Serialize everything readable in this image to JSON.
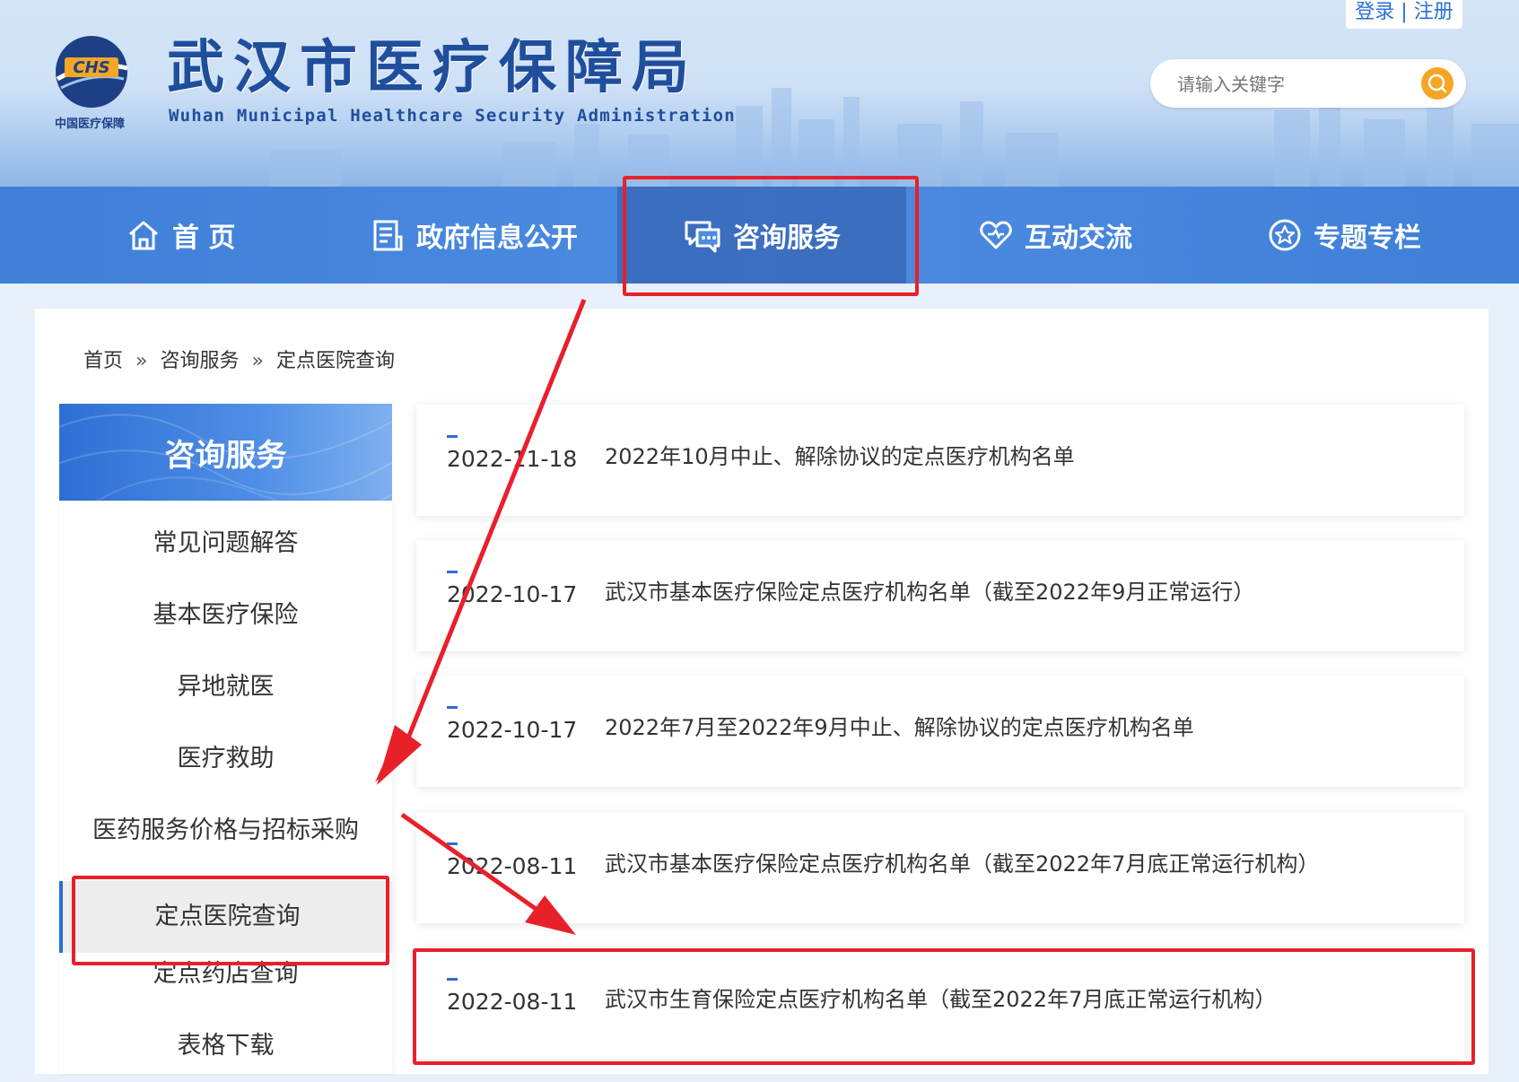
{
  "header": {
    "logo_text": "中国医疗保障",
    "title": "武汉市医疗保障局",
    "subtitle": "Wuhan Municipal Healthcare Security Administration",
    "login": "登录",
    "separator": "|",
    "register": "注册",
    "search_placeholder": "请输入关键字"
  },
  "nav": {
    "items": [
      {
        "label": "首 页",
        "icon": "home-icon"
      },
      {
        "label": "政府信息公开",
        "icon": "document-icon"
      },
      {
        "label": "咨询服务",
        "icon": "chat-icon",
        "active": true
      },
      {
        "label": "互动交流",
        "icon": "heart-icon"
      },
      {
        "label": "专题专栏",
        "icon": "star-icon"
      }
    ]
  },
  "breadcrumb": {
    "home": "首页",
    "sep": "»",
    "level1": "咨询服务",
    "level2": "定点医院查询"
  },
  "sidebar": {
    "title": "咨询服务",
    "items": [
      {
        "label": "常见问题解答"
      },
      {
        "label": "基本医疗保险"
      },
      {
        "label": "异地就医"
      },
      {
        "label": "医疗救助"
      },
      {
        "label": "医药服务价格与招标采购"
      },
      {
        "label": "定点医院查询",
        "active": true
      },
      {
        "label": "定点药店查询"
      },
      {
        "label": "表格下载"
      }
    ]
  },
  "articles": [
    {
      "date": "2022-11-18",
      "title": "2022年10月中止、解除协议的定点医疗机构名单"
    },
    {
      "date": "2022-10-17",
      "title": "武汉市基本医疗保险定点医疗机构名单（截至2022年9月正常运行）"
    },
    {
      "date": "2022-10-17",
      "title": "2022年7月至2022年9月中止、解除协议的定点医疗机构名单"
    },
    {
      "date": "2022-08-11",
      "title": "武汉市基本医疗保险定点医疗机构名单（截至2022年7月底正常运行机构）"
    },
    {
      "date": "2022-08-11",
      "title": "武汉市生育保险定点医疗机构名单（截至2022年7月底正常运行机构）"
    }
  ],
  "colors": {
    "nav_blue": "#4d8ce0",
    "title_blue": "#1f4e9c",
    "accent_orange": "#f5a623",
    "annotation_red": "#e8202a"
  }
}
